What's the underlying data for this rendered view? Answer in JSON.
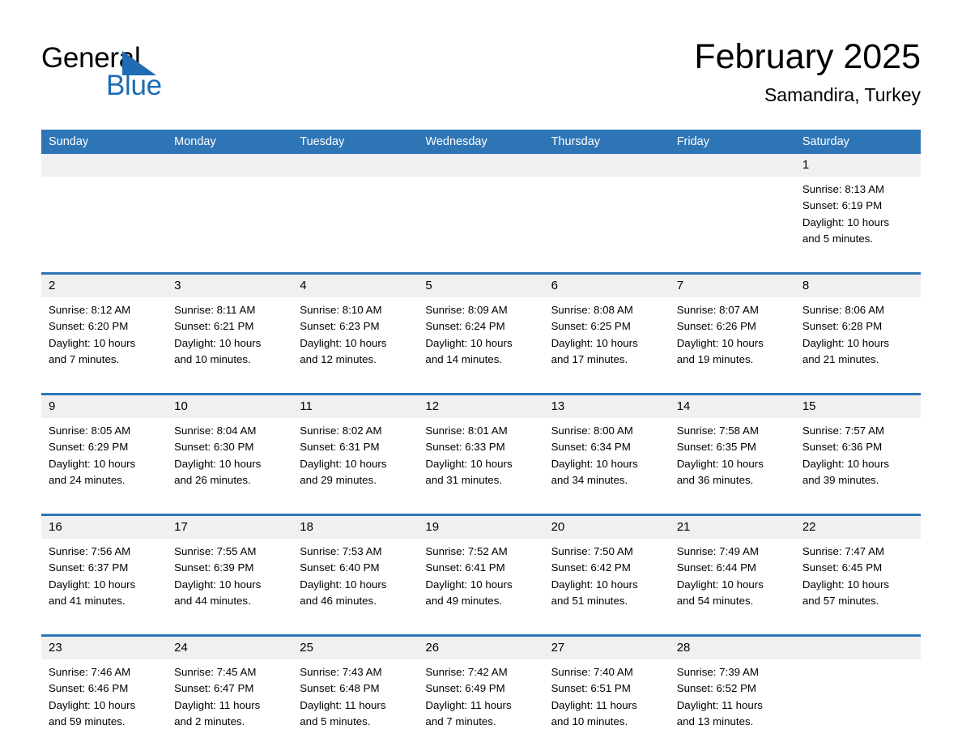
{
  "logo": {
    "word1": "General",
    "word2": "Blue",
    "triangle_color": "#1f6cb4"
  },
  "header": {
    "title": "February 2025",
    "subtitle": "Samandira, Turkey"
  },
  "theme": {
    "header_blue": "#2e75b6",
    "daynum_band": "#f0f0f0",
    "text": "#000000",
    "page_bg": "#ffffff"
  },
  "weekdays": [
    "Sunday",
    "Monday",
    "Tuesday",
    "Wednesday",
    "Thursday",
    "Friday",
    "Saturday"
  ],
  "weeks": [
    [
      {
        "day": "",
        "lines": []
      },
      {
        "day": "",
        "lines": []
      },
      {
        "day": "",
        "lines": []
      },
      {
        "day": "",
        "lines": []
      },
      {
        "day": "",
        "lines": []
      },
      {
        "day": "",
        "lines": []
      },
      {
        "day": "1",
        "lines": [
          "Sunrise: 8:13 AM",
          "Sunset: 6:19 PM",
          "Daylight: 10 hours",
          "and 5 minutes."
        ]
      }
    ],
    [
      {
        "day": "2",
        "lines": [
          "Sunrise: 8:12 AM",
          "Sunset: 6:20 PM",
          "Daylight: 10 hours",
          "and 7 minutes."
        ]
      },
      {
        "day": "3",
        "lines": [
          "Sunrise: 8:11 AM",
          "Sunset: 6:21 PM",
          "Daylight: 10 hours",
          "and 10 minutes."
        ]
      },
      {
        "day": "4",
        "lines": [
          "Sunrise: 8:10 AM",
          "Sunset: 6:23 PM",
          "Daylight: 10 hours",
          "and 12 minutes."
        ]
      },
      {
        "day": "5",
        "lines": [
          "Sunrise: 8:09 AM",
          "Sunset: 6:24 PM",
          "Daylight: 10 hours",
          "and 14 minutes."
        ]
      },
      {
        "day": "6",
        "lines": [
          "Sunrise: 8:08 AM",
          "Sunset: 6:25 PM",
          "Daylight: 10 hours",
          "and 17 minutes."
        ]
      },
      {
        "day": "7",
        "lines": [
          "Sunrise: 8:07 AM",
          "Sunset: 6:26 PM",
          "Daylight: 10 hours",
          "and 19 minutes."
        ]
      },
      {
        "day": "8",
        "lines": [
          "Sunrise: 8:06 AM",
          "Sunset: 6:28 PM",
          "Daylight: 10 hours",
          "and 21 minutes."
        ]
      }
    ],
    [
      {
        "day": "9",
        "lines": [
          "Sunrise: 8:05 AM",
          "Sunset: 6:29 PM",
          "Daylight: 10 hours",
          "and 24 minutes."
        ]
      },
      {
        "day": "10",
        "lines": [
          "Sunrise: 8:04 AM",
          "Sunset: 6:30 PM",
          "Daylight: 10 hours",
          "and 26 minutes."
        ]
      },
      {
        "day": "11",
        "lines": [
          "Sunrise: 8:02 AM",
          "Sunset: 6:31 PM",
          "Daylight: 10 hours",
          "and 29 minutes."
        ]
      },
      {
        "day": "12",
        "lines": [
          "Sunrise: 8:01 AM",
          "Sunset: 6:33 PM",
          "Daylight: 10 hours",
          "and 31 minutes."
        ]
      },
      {
        "day": "13",
        "lines": [
          "Sunrise: 8:00 AM",
          "Sunset: 6:34 PM",
          "Daylight: 10 hours",
          "and 34 minutes."
        ]
      },
      {
        "day": "14",
        "lines": [
          "Sunrise: 7:58 AM",
          "Sunset: 6:35 PM",
          "Daylight: 10 hours",
          "and 36 minutes."
        ]
      },
      {
        "day": "15",
        "lines": [
          "Sunrise: 7:57 AM",
          "Sunset: 6:36 PM",
          "Daylight: 10 hours",
          "and 39 minutes."
        ]
      }
    ],
    [
      {
        "day": "16",
        "lines": [
          "Sunrise: 7:56 AM",
          "Sunset: 6:37 PM",
          "Daylight: 10 hours",
          "and 41 minutes."
        ]
      },
      {
        "day": "17",
        "lines": [
          "Sunrise: 7:55 AM",
          "Sunset: 6:39 PM",
          "Daylight: 10 hours",
          "and 44 minutes."
        ]
      },
      {
        "day": "18",
        "lines": [
          "Sunrise: 7:53 AM",
          "Sunset: 6:40 PM",
          "Daylight: 10 hours",
          "and 46 minutes."
        ]
      },
      {
        "day": "19",
        "lines": [
          "Sunrise: 7:52 AM",
          "Sunset: 6:41 PM",
          "Daylight: 10 hours",
          "and 49 minutes."
        ]
      },
      {
        "day": "20",
        "lines": [
          "Sunrise: 7:50 AM",
          "Sunset: 6:42 PM",
          "Daylight: 10 hours",
          "and 51 minutes."
        ]
      },
      {
        "day": "21",
        "lines": [
          "Sunrise: 7:49 AM",
          "Sunset: 6:44 PM",
          "Daylight: 10 hours",
          "and 54 minutes."
        ]
      },
      {
        "day": "22",
        "lines": [
          "Sunrise: 7:47 AM",
          "Sunset: 6:45 PM",
          "Daylight: 10 hours",
          "and 57 minutes."
        ]
      }
    ],
    [
      {
        "day": "23",
        "lines": [
          "Sunrise: 7:46 AM",
          "Sunset: 6:46 PM",
          "Daylight: 10 hours",
          "and 59 minutes."
        ]
      },
      {
        "day": "24",
        "lines": [
          "Sunrise: 7:45 AM",
          "Sunset: 6:47 PM",
          "Daylight: 11 hours",
          "and 2 minutes."
        ]
      },
      {
        "day": "25",
        "lines": [
          "Sunrise: 7:43 AM",
          "Sunset: 6:48 PM",
          "Daylight: 11 hours",
          "and 5 minutes."
        ]
      },
      {
        "day": "26",
        "lines": [
          "Sunrise: 7:42 AM",
          "Sunset: 6:49 PM",
          "Daylight: 11 hours",
          "and 7 minutes."
        ]
      },
      {
        "day": "27",
        "lines": [
          "Sunrise: 7:40 AM",
          "Sunset: 6:51 PM",
          "Daylight: 11 hours",
          "and 10 minutes."
        ]
      },
      {
        "day": "28",
        "lines": [
          "Sunrise: 7:39 AM",
          "Sunset: 6:52 PM",
          "Daylight: 11 hours",
          "and 13 minutes."
        ]
      },
      {
        "day": "",
        "lines": []
      }
    ]
  ]
}
